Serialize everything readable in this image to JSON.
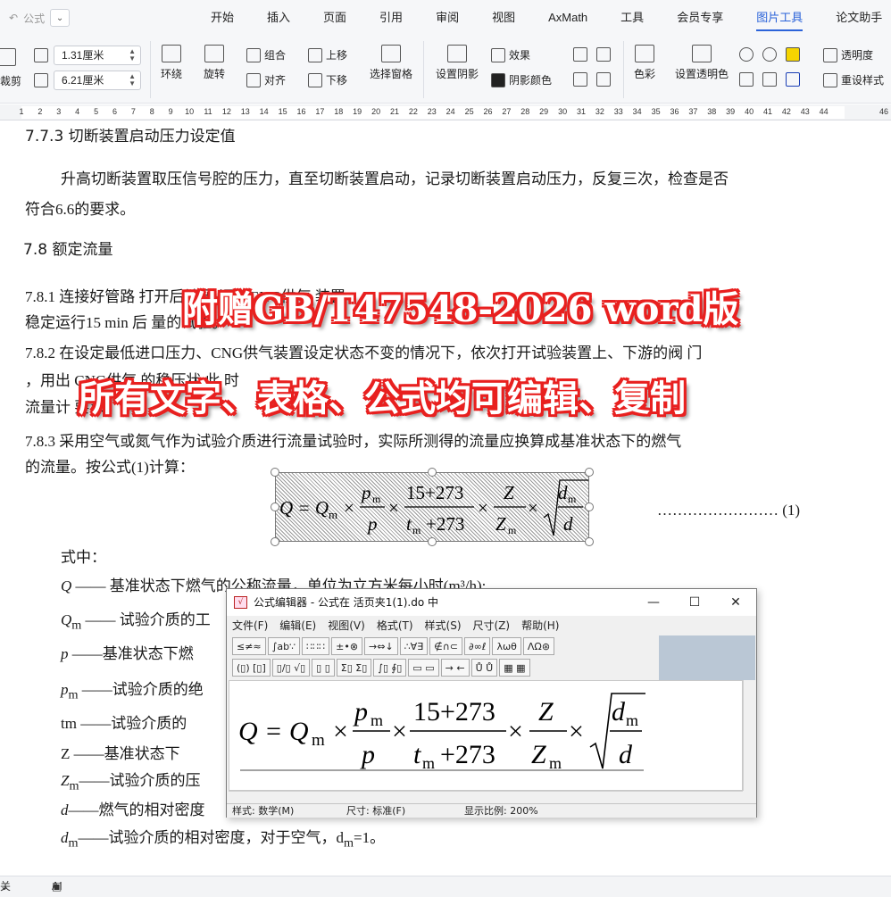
{
  "menubar": {
    "quick_label": "公式",
    "tabs": [
      "开始",
      "插入",
      "页面",
      "引用",
      "审阅",
      "视图",
      "AxMath",
      "工具",
      "会员专享",
      "图片工具",
      "论文助手"
    ],
    "active_tab": "图片工具"
  },
  "ribbon": {
    "crop_label": "裁剪",
    "width_value": "1.31厘米",
    "height_value": "6.21厘米",
    "wrap_label": "环绕",
    "rotate_label": "旋转",
    "group_label": "组合",
    "align_label": "对齐",
    "bring_forward_label": "上移",
    "send_backward_label": "下移",
    "selection_pane_label": "选择窗格",
    "shadow_settings_label": "设置阴影",
    "effects_label": "效果",
    "shadow_color_label": "阴影颜色",
    "color_label": "色彩",
    "set_transparent_label": "设置透明色",
    "transparency_label": "透明度",
    "reset_style_label": "重设样式"
  },
  "ruler": {
    "ticks": [
      "1",
      "2",
      "3",
      "4",
      "5",
      "6",
      "7",
      "8",
      "9",
      "10",
      "11",
      "12",
      "13",
      "14",
      "15",
      "16",
      "17",
      "18",
      "19",
      "20",
      "21",
      "22",
      "23",
      "24",
      "25",
      "26",
      "27",
      "28",
      "29",
      "30",
      "31",
      "32",
      "33",
      "34",
      "35",
      "36",
      "37",
      "38",
      "39",
      "40",
      "41",
      "42",
      "43",
      "44",
      "46"
    ]
  },
  "document": {
    "cut_heading": "7.7.3  切断装置启动压力设定值",
    "p1_line1": "升高切断装置取压信号腔的压力，直至切断装置启动，记录切断装置启动压力，反复三次，检查是否",
    "p1_line2": "符合6.6的要求。",
    "h78": "7.8  额定流量",
    "p781_line1": "7.8.1  连接好管路                                                    打开后端阀 调整CNG供气 装置",
    "p781_line2": "稳定运行15 min  后              量的试验。",
    "p782_line1": "7.8.2  在设定最低进口压力、CNG供气装置设定状态不变的情况下，依次打开试验装置上、下游的阀 门",
    "p782_line2": "，用出                          CNG供气                                     的稳压状              此 时",
    "p782_line3": "流量计                                                                     要求。",
    "p783_line1": "7.8.3  采用空气或氮气作为试验介质进行流量试验时，实际所测得的流量应换算成基准状态下的燃气",
    "p783_line2": "的流量。按公式(1)计算：",
    "eq_number": "…………………… (1)",
    "where": "式中：",
    "defs": [
      {
        "sym": "Q",
        "sub": "",
        "text": "—— 基准状态下燃气的公称流量，单位为立方米每小时(m³/h);"
      },
      {
        "sym": "Q",
        "sub": "m",
        "text": "—— 试验介质的工"
      },
      {
        "sym": "p",
        "sub": "",
        "text": "——基准状态下燃"
      },
      {
        "sym": "p",
        "sub": "m",
        "text": "——试验介质的绝"
      },
      {
        "sym": "tm",
        "sub": "",
        "text": "——试验介质的"
      },
      {
        "sym": "Z",
        "sub": "",
        "text": "——基准状态下"
      },
      {
        "sym": "Z",
        "sub": "m",
        "text": "——试验介质的压"
      },
      {
        "sym": "d",
        "sub": "",
        "text": "——燃气的相对密度"
      },
      {
        "sym": "d",
        "sub": "m",
        "text": "——试验介质的相对密度，对于空气，d"
      }
    ],
    "last_def_tail": "=1。"
  },
  "banners": {
    "top": "附赠GB/T47548-2026 word版",
    "bottom": "所有文字、表格、公式均可编辑、复制"
  },
  "equation_editor": {
    "title": "公式编辑器 - 公式在 活页夹1(1).do 中",
    "menu": [
      "文件(F)",
      "编辑(E)",
      "视图(V)",
      "格式(T)",
      "样式(S)",
      "尺寸(Z)",
      "帮助(H)"
    ],
    "palette_row1": [
      "≤≠≈",
      "∫ab∵",
      "∷∷∷",
      "±•⊗",
      "→⇔↓",
      "∴∀∃",
      "∉∩⊂",
      "∂∞ℓ",
      "λωθ",
      "ΛΩ⊛"
    ],
    "palette_row2": [
      "(▯) [▯]",
      "▯/▯ √▯",
      "▯ ▯",
      "Σ▯ Σ▯",
      "∫▯ ∮▯",
      "▭ ▭",
      "→ ←",
      "Ů Ů",
      "▦ ▦"
    ],
    "status_style": "样式: 数学(M)",
    "status_size": "尺寸: 标准(F)",
    "status_zoom": "显示比例: 200%"
  },
  "statusbar": {
    "close_label": "关闭",
    "ai_label": "AI 校对"
  }
}
